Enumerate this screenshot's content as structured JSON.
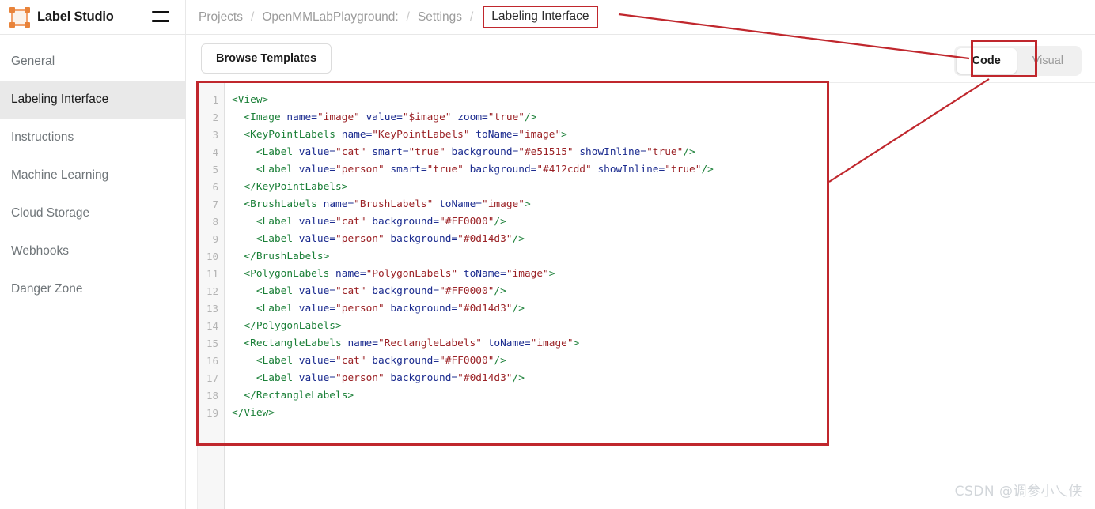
{
  "app": {
    "brand_name": "Label Studio",
    "logo_icon": "bounding-box-icon",
    "menu_icon": "hamburger-icon"
  },
  "breadcrumb": {
    "separator": "/",
    "items": [
      {
        "label": "Projects",
        "current": false
      },
      {
        "label": "OpenMMLabPlayground:",
        "current": false
      },
      {
        "label": "Settings",
        "current": false
      },
      {
        "label": "Labeling Interface",
        "current": true
      }
    ]
  },
  "sidebar": {
    "items": [
      {
        "label": "General",
        "active": false
      },
      {
        "label": "Labeling Interface",
        "active": true
      },
      {
        "label": "Instructions",
        "active": false
      },
      {
        "label": "Machine Learning",
        "active": false
      },
      {
        "label": "Cloud Storage",
        "active": false
      },
      {
        "label": "Webhooks",
        "active": false
      },
      {
        "label": "Danger Zone",
        "active": false
      }
    ]
  },
  "toolbar": {
    "browse_templates_label": "Browse Templates",
    "mode_toggle": {
      "options": [
        "Code",
        "Visual"
      ],
      "selected": "Code",
      "code_label": "Code",
      "visual_label": "Visual"
    }
  },
  "editor": {
    "line_count": 19,
    "line_numbers": [
      1,
      2,
      3,
      4,
      5,
      6,
      7,
      8,
      9,
      10,
      11,
      12,
      13,
      14,
      15,
      16,
      17,
      18,
      19
    ],
    "lines": [
      {
        "n": 1,
        "indent": 0,
        "text": "<View>"
      },
      {
        "n": 2,
        "indent": 1,
        "text": "<Image name=\"image\" value=\"$image\" zoom=\"true\"/>"
      },
      {
        "n": 3,
        "indent": 1,
        "text": "<KeyPointLabels name=\"KeyPointLabels\" toName=\"image\">"
      },
      {
        "n": 4,
        "indent": 2,
        "text": "<Label value=\"cat\" smart=\"true\" background=\"#e51515\" showInline=\"true\"/>"
      },
      {
        "n": 5,
        "indent": 2,
        "text": "<Label value=\"person\" smart=\"true\" background=\"#412cdd\" showInline=\"true\"/>"
      },
      {
        "n": 6,
        "indent": 1,
        "text": "</KeyPointLabels>"
      },
      {
        "n": 7,
        "indent": 1,
        "text": "<BrushLabels name=\"BrushLabels\" toName=\"image\">"
      },
      {
        "n": 8,
        "indent": 2,
        "text": "<Label value=\"cat\" background=\"#FF0000\"/>"
      },
      {
        "n": 9,
        "indent": 2,
        "text": "<Label value=\"person\" background=\"#0d14d3\"/>"
      },
      {
        "n": 10,
        "indent": 1,
        "text": "</BrushLabels>"
      },
      {
        "n": 11,
        "indent": 1,
        "text": "<PolygonLabels name=\"PolygonLabels\" toName=\"image\">"
      },
      {
        "n": 12,
        "indent": 2,
        "text": "<Label value=\"cat\" background=\"#FF0000\"/>"
      },
      {
        "n": 13,
        "indent": 2,
        "text": "<Label value=\"person\" background=\"#0d14d3\"/>"
      },
      {
        "n": 14,
        "indent": 1,
        "text": "</PolygonLabels>"
      },
      {
        "n": 15,
        "indent": 1,
        "text": "<RectangleLabels name=\"RectangleLabels\" toName=\"image\">"
      },
      {
        "n": 16,
        "indent": 2,
        "text": "<Label value=\"cat\" background=\"#FF0000\"/>"
      },
      {
        "n": 17,
        "indent": 2,
        "text": "<Label value=\"person\" background=\"#0d14d3\"/>"
      },
      {
        "n": 18,
        "indent": 1,
        "text": "</RectangleLabels>"
      },
      {
        "n": 19,
        "indent": 0,
        "text": "</View>"
      }
    ]
  },
  "annotations": {
    "highlight_color": "#c0272d",
    "boxes": [
      "breadcrumb-current",
      "code-editor",
      "code-toggle-button"
    ],
    "arrows": [
      "breadcrumb-to-code-toggle",
      "code-toggle-to-editor"
    ]
  },
  "watermark": {
    "text": "CSDN @调参小乀侠"
  },
  "colors": {
    "accent": "#e8833a",
    "annotation_red": "#c0272d",
    "sidebar_active_bg": "#e9e9e9",
    "syntax_tag": "#1a7f37",
    "syntax_attr": "#1b2b8f",
    "syntax_value": "#9b2226"
  }
}
